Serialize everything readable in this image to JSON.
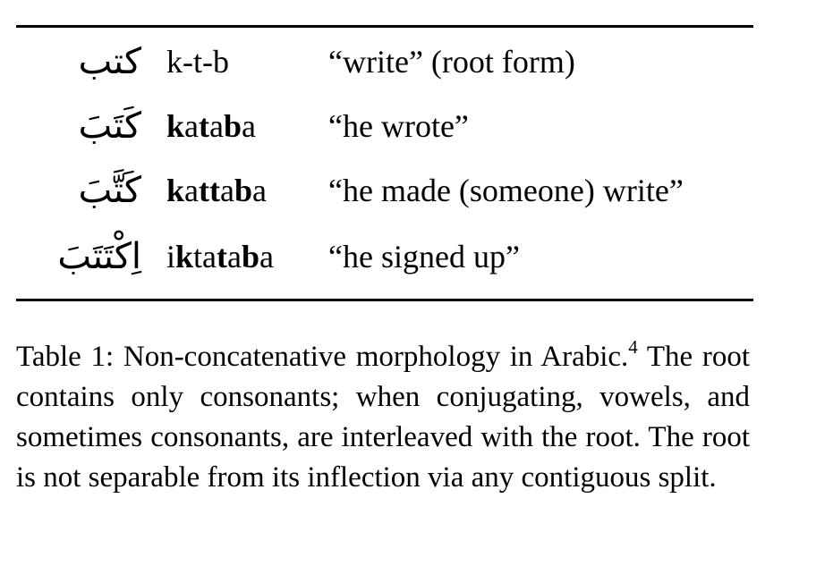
{
  "table": {
    "rows": [
      {
        "arabic": "كتب",
        "translit": [
          {
            "text": "k-t-b",
            "bold": false
          }
        ],
        "gloss": "“write” (root form)"
      },
      {
        "arabic": "كَتَبَ",
        "translit": [
          {
            "text": "k",
            "bold": true
          },
          {
            "text": "a",
            "bold": false
          },
          {
            "text": "t",
            "bold": true
          },
          {
            "text": "a",
            "bold": false
          },
          {
            "text": "b",
            "bold": true
          },
          {
            "text": "a",
            "bold": false
          }
        ],
        "gloss": "“he wrote”"
      },
      {
        "arabic": "كَتَّبَ",
        "translit": [
          {
            "text": "k",
            "bold": true
          },
          {
            "text": "a",
            "bold": false
          },
          {
            "text": "tt",
            "bold": true
          },
          {
            "text": "a",
            "bold": false
          },
          {
            "text": "b",
            "bold": true
          },
          {
            "text": "a",
            "bold": false
          }
        ],
        "gloss": "“he made (someone) write”"
      },
      {
        "arabic": "اِكْتَتَبَ",
        "translit": [
          {
            "text": "i",
            "bold": false
          },
          {
            "text": "k",
            "bold": true
          },
          {
            "text": "ta",
            "bold": false
          },
          {
            "text": "t",
            "bold": true
          },
          {
            "text": "a",
            "bold": false
          },
          {
            "text": "b",
            "bold": true
          },
          {
            "text": "a",
            "bold": false
          }
        ],
        "gloss": "“he signed up”"
      }
    ]
  },
  "caption": {
    "label": "Table 1:",
    "title": "Non-concatenative morphology in Arabic.",
    "footnote": "4",
    "body": "The root contains only consonants; when conjugating, vowels, and sometimes consonants, are interleaved with the root. The root is not separable from its inflection via any contiguous split."
  }
}
